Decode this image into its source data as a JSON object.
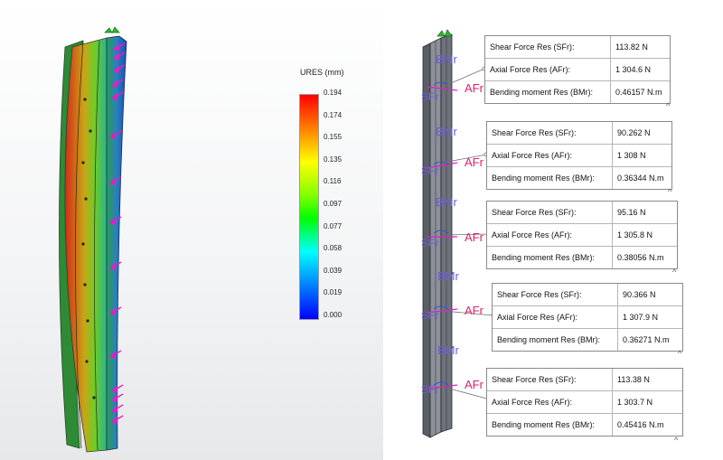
{
  "legend": {
    "title": "URES (mm)",
    "ticks": [
      "0.194",
      "0.174",
      "0.155",
      "0.135",
      "0.116",
      "0.097",
      "0.077",
      "0.058",
      "0.039",
      "0.019",
      "0.000"
    ]
  },
  "labels": {
    "bending_marker": "BMr",
    "axial_marker": "AFr",
    "shear_marker": "SFr"
  },
  "results": [
    {
      "shear_label": "Shear Force Res (SFr):",
      "shear_value": "113.82 N",
      "axial_label": "Axial Force Res (AFr):",
      "axial_value": "1 304.6 N",
      "bending_label": "Bending moment Res (BMr):",
      "bending_value": "0.46157 N.m"
    },
    {
      "shear_label": "Shear Force Res (SFr):",
      "shear_value": "90.262 N",
      "axial_label": "Axial Force Res (AFr):",
      "axial_value": "1 308 N",
      "bending_label": "Bending moment Res (BMr):",
      "bending_value": "0.36344 N.m"
    },
    {
      "shear_label": "Shear Force Res (SFr):",
      "shear_value": "95.16 N",
      "axial_label": "Axial Force Res (AFr):",
      "axial_value": "1 305.8 N",
      "bending_label": "Bending moment Res (BMr):",
      "bending_value": "0.38056 N.m"
    },
    {
      "shear_label": "Shear Force Res (SFr):",
      "shear_value": "90.366 N",
      "axial_label": "Axial Force Res (AFr):",
      "axial_value": "1 307.9 N",
      "bending_label": "Bending moment Res (BMr):",
      "bending_value": "0.36271 N.m"
    },
    {
      "shear_label": "Shear Force Res (SFr):",
      "shear_value": "113.38 N",
      "axial_label": "Axial Force Res (AFr):",
      "axial_value": "1 303.7 N",
      "bending_label": "Bending moment Res (BMr):",
      "bending_value": "0.45416 N.m"
    }
  ],
  "colors": {
    "arrow_magenta": "#e020c8",
    "axial_text": "#e0206a",
    "bending_text": "#6a5ce0",
    "fixture_green": "#2eb82e"
  }
}
